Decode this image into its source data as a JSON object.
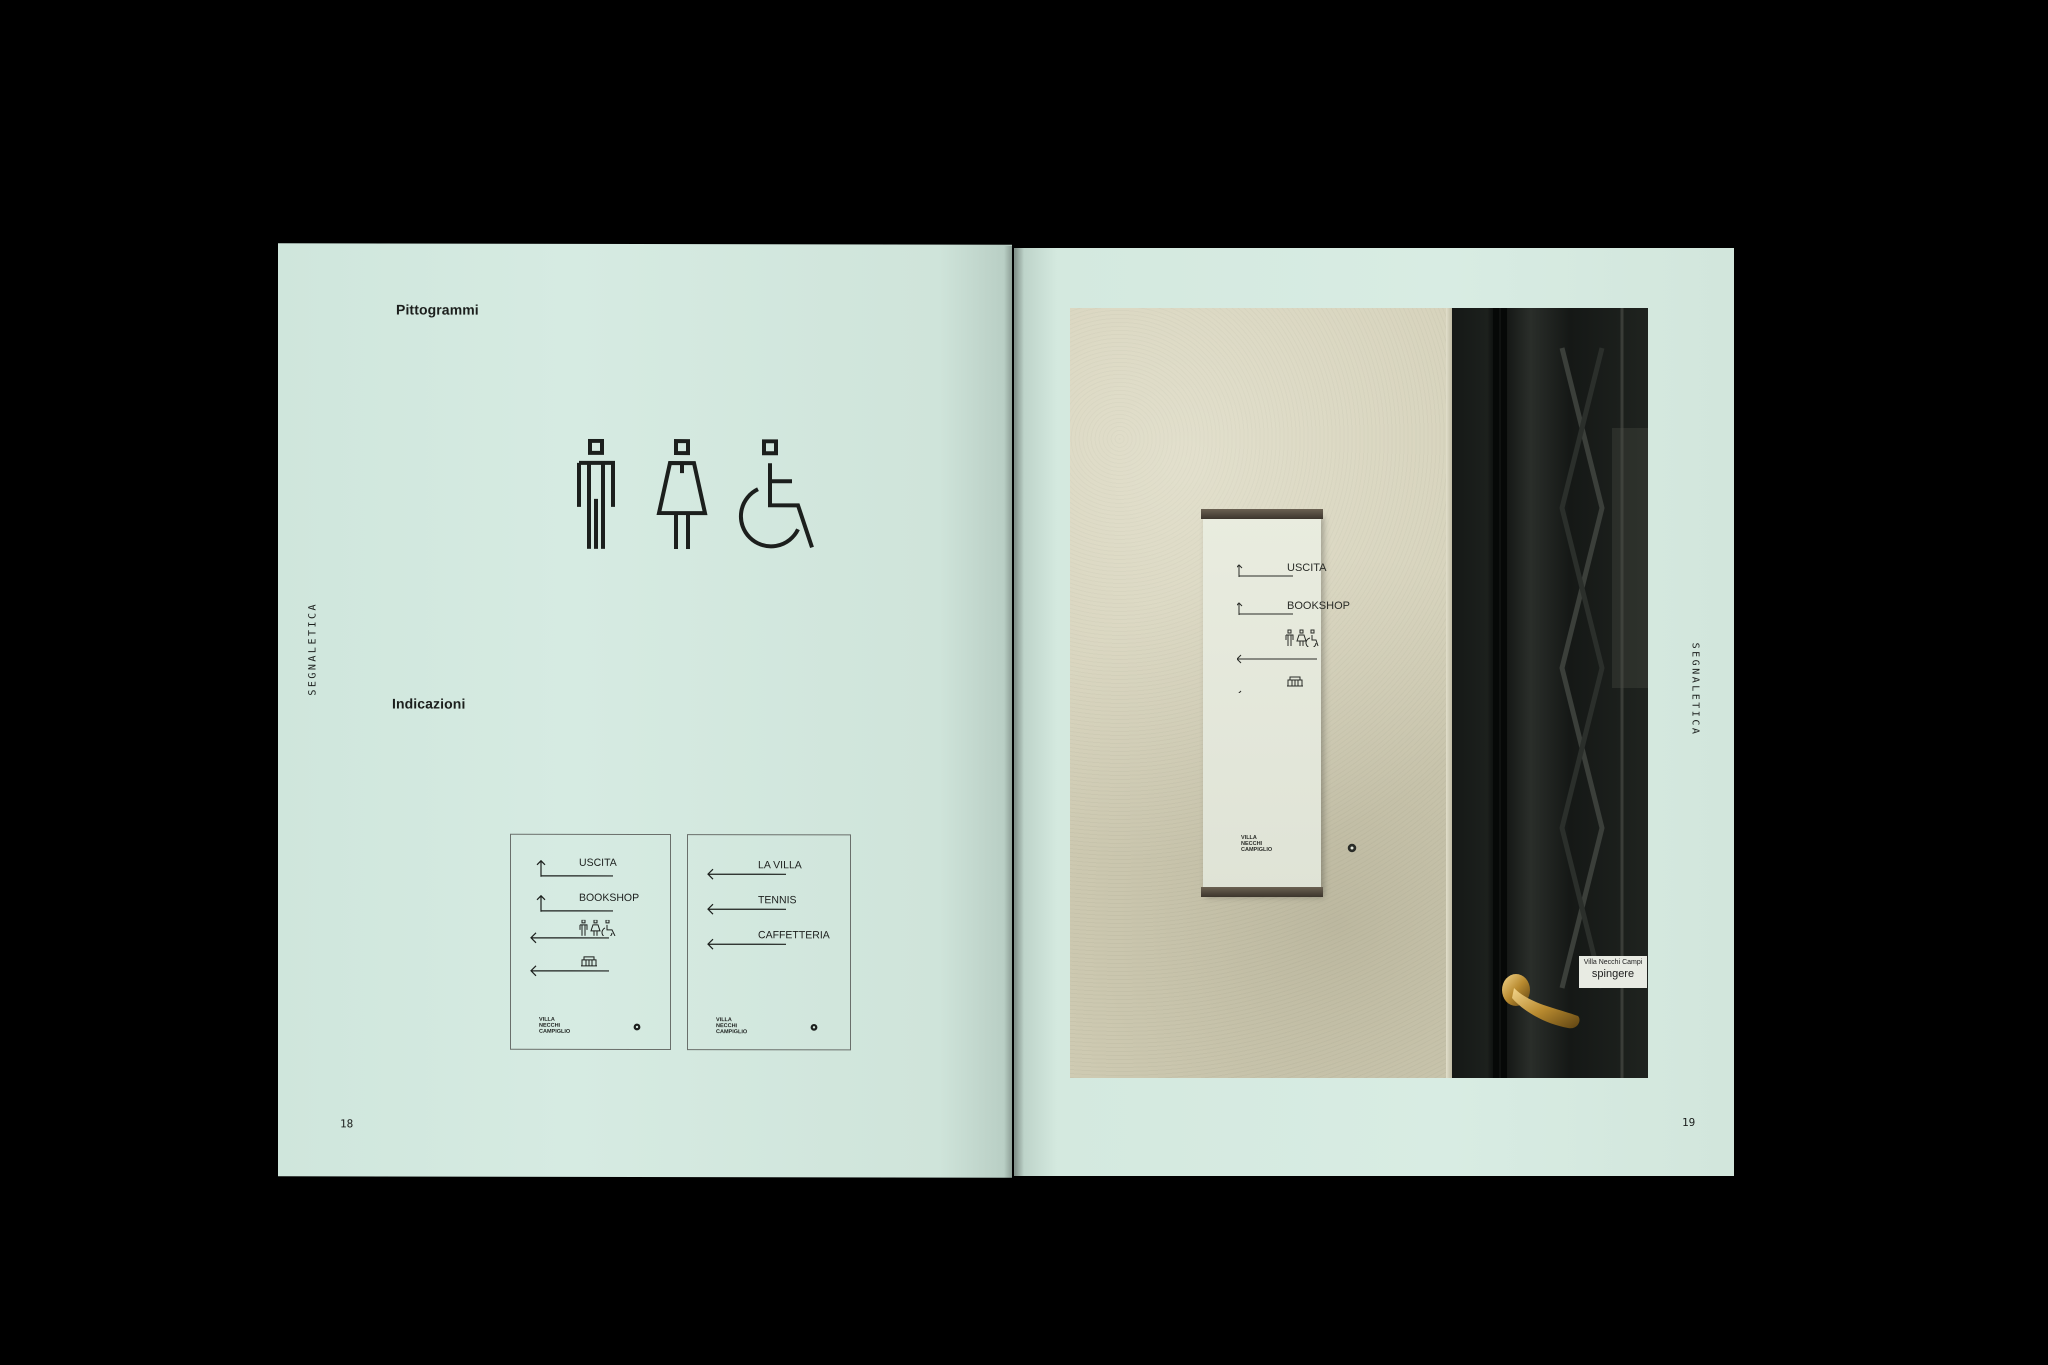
{
  "left_page": {
    "heading_pictograms": "Pittogrammi",
    "heading_directions": "Indicazioni",
    "section_label": "SEGNALETICA",
    "page_number": "18",
    "pictograms": [
      "man-icon",
      "woman-icon",
      "wheelchair-icon"
    ],
    "sign_cards": [
      {
        "rows": [
          {
            "direction": "up",
            "label": "USCITA"
          },
          {
            "direction": "up",
            "label": "BOOKSHOP"
          },
          {
            "direction": "left",
            "label": "",
            "icons": [
              "man-icon",
              "woman-icon",
              "wheelchair-icon"
            ]
          },
          {
            "direction": "left",
            "label": "",
            "icons": [
              "shop-icon"
            ]
          }
        ],
        "logo": [
          "VILLA",
          "NECCHI",
          "CAMPIGLIO"
        ]
      },
      {
        "rows": [
          {
            "direction": "left",
            "label": "LA VILLA"
          },
          {
            "direction": "left",
            "label": "TENNIS"
          },
          {
            "direction": "left",
            "label": "CAFFETTERIA"
          }
        ],
        "logo": [
          "VILLA",
          "NECCHI",
          "CAMPIGLIO"
        ]
      }
    ]
  },
  "right_page": {
    "section_label": "SEGNALETICA",
    "page_number": "19",
    "photo": {
      "sign_labels": [
        "USCITA",
        "BOOKSHOP"
      ],
      "sign_logo": [
        "VILLA",
        "NECCHI",
        "CAMPIGLIO"
      ],
      "door_sticker_line1": "Villa Necchi Campi",
      "door_sticker_line2": "spingere"
    }
  },
  "colors": {
    "page": "#d4e9df",
    "ink": "#1c1f1d",
    "background": "#000000"
  }
}
